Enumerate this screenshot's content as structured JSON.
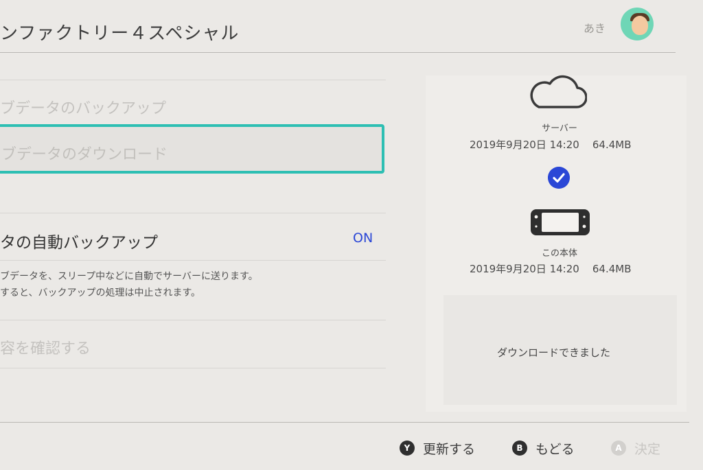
{
  "header": {
    "title": "ンファクトリー４スペシャル",
    "user_name": "あき"
  },
  "menu": {
    "backup_label": "ブデータのバックアップ",
    "download_label": "ブデータのダウンロード",
    "auto_backup_label": "タの自動バックアップ",
    "auto_backup_value": "ON",
    "description_line1": "ブデータを、スリープ中などに自動でサーバーに送ります。",
    "description_line2": "すると、バックアップの処理は中止されます。",
    "confirm_label": "容を確認する"
  },
  "panel": {
    "server_label": "サーバー",
    "server_date": "2019年9月20日 14:20",
    "server_size": "64.4MB",
    "console_label": "この本体",
    "console_date": "2019年9月20日 14:20",
    "console_size": "64.4MB",
    "status_message": "ダウンロードできました"
  },
  "footer": {
    "refresh": {
      "key": "Y",
      "label": "更新する"
    },
    "back": {
      "key": "B",
      "label": "もどる"
    },
    "confirm": {
      "key": "A",
      "label": "決定"
    }
  },
  "icons": {
    "cloud": "cloud-icon",
    "check": "check-icon",
    "console": "switch-console-icon"
  },
  "colors": {
    "accent_teal": "#2dbfb3",
    "accent_blue": "#2b47d6",
    "avatar_bg": "#6fd6b6"
  }
}
